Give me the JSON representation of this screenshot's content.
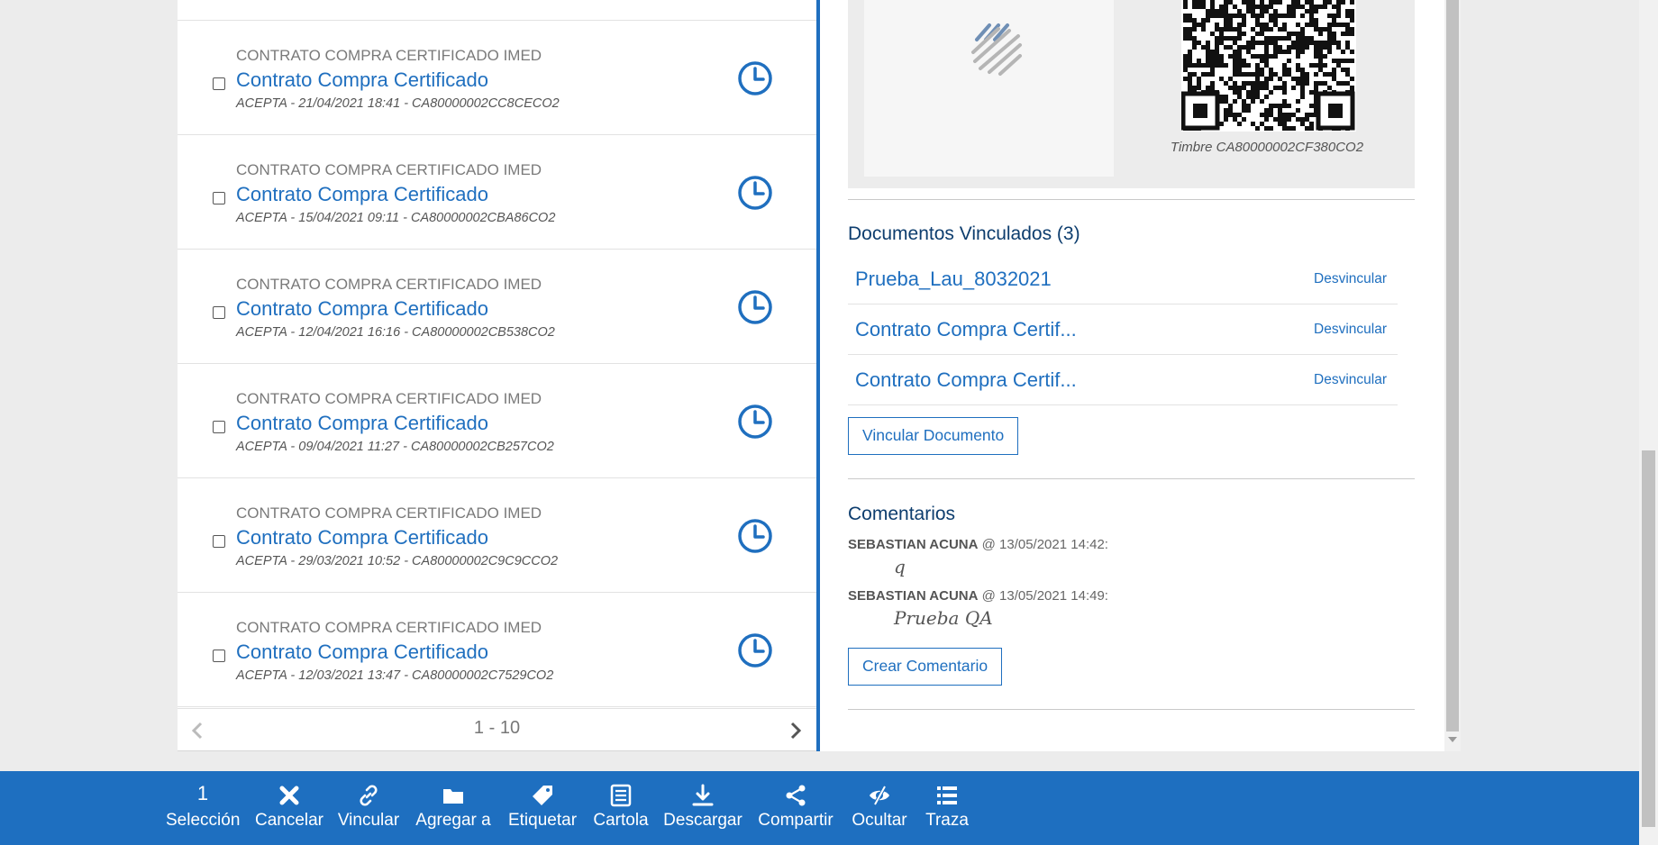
{
  "list": {
    "items": [
      {
        "category": "CONTRATO COMPRA CERTIFICADO IMED",
        "title": "Contrato Compra Certificado",
        "subtitle": "ACEPTA - 21/04/2021 18:41 - CA80000002CC8CECO2"
      },
      {
        "category": "CONTRATO COMPRA CERTIFICADO IMED",
        "title": "Contrato Compra Certificado",
        "subtitle": "ACEPTA - 15/04/2021 09:11 - CA80000002CBA86CO2"
      },
      {
        "category": "CONTRATO COMPRA CERTIFICADO IMED",
        "title": "Contrato Compra Certificado",
        "subtitle": "ACEPTA - 12/04/2021 16:16 - CA80000002CB538CO2"
      },
      {
        "category": "CONTRATO COMPRA CERTIFICADO IMED",
        "title": "Contrato Compra Certificado",
        "subtitle": "ACEPTA - 09/04/2021 11:27 - CA80000002CB257CO2"
      },
      {
        "category": "CONTRATO COMPRA CERTIFICADO IMED",
        "title": "Contrato Compra Certificado",
        "subtitle": "ACEPTA - 29/03/2021 10:52 - CA80000002C9C9CCO2"
      },
      {
        "category": "CONTRATO COMPRA CERTIFICADO IMED",
        "title": "Contrato Compra Certificado",
        "subtitle": "ACEPTA - 12/03/2021 13:47 - CA80000002C7529CO2"
      }
    ],
    "pager": {
      "range": "1 - 10"
    }
  },
  "detail": {
    "timbre": "Timbre CA80000002CF380CO2",
    "linked": {
      "title": "Documentos Vinculados (3)",
      "docs": [
        {
          "name": "Prueba_Lau_8032021",
          "action": "Desvincular"
        },
        {
          "name": "Contrato Compra Certif...",
          "action": "Desvincular"
        },
        {
          "name": "Contrato Compra Certif...",
          "action": "Desvincular"
        }
      ],
      "link_button": "Vincular Documento"
    },
    "comments": {
      "title": "Comentarios",
      "items": [
        {
          "author": "SEBASTIAN ACUNA",
          "meta": " @ 13/05/2021 14:42:",
          "text": "q"
        },
        {
          "author": "SEBASTIAN ACUNA",
          "meta": " @ 13/05/2021 14:49:",
          "text": "Prueba QA"
        }
      ],
      "create_button": "Crear Comentario"
    }
  },
  "toolbar": {
    "selection_count": "1",
    "items": [
      {
        "label": "Selección",
        "icon": "selection-count"
      },
      {
        "label": "Cancelar",
        "icon": "x-icon"
      },
      {
        "label": "Vincular",
        "icon": "link-icon"
      },
      {
        "label": "Agregar a",
        "icon": "folder-icon"
      },
      {
        "label": "Etiquetar",
        "icon": "tag-icon"
      },
      {
        "label": "Cartola",
        "icon": "list-doc-icon"
      },
      {
        "label": "Descargar",
        "icon": "download-icon"
      },
      {
        "label": "Compartir",
        "icon": "share-icon"
      },
      {
        "label": "Ocultar",
        "icon": "eye-slash-icon"
      },
      {
        "label": "Traza",
        "icon": "list-icon"
      }
    ]
  },
  "colors": {
    "accent": "#1f6fbf",
    "toolbar": "#1e6fc0",
    "heading": "#0d3d6e"
  }
}
